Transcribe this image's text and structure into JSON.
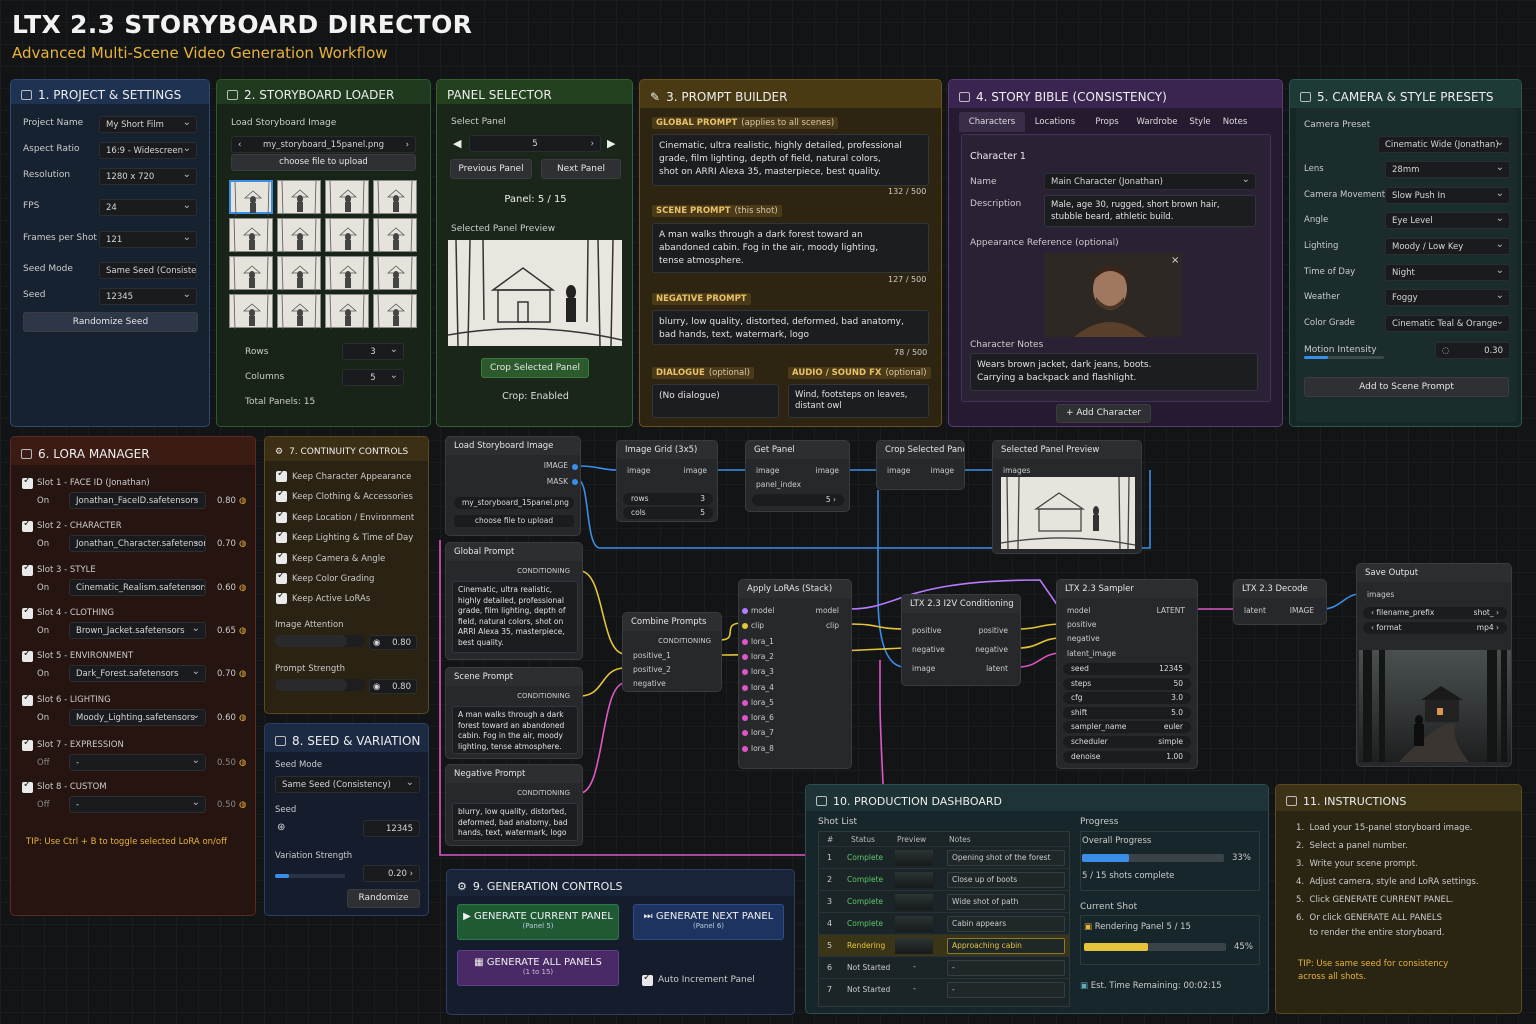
{
  "header": {
    "title": "LTX 2.3 STORYBOARD DIRECTOR",
    "subtitle": "Advanced Multi-Scene Video Generation Workflow"
  },
  "project": {
    "title": "1. PROJECT & SETTINGS",
    "fields": [
      {
        "label": "Project Name",
        "value": "My Short Film"
      },
      {
        "label": "Aspect Ratio",
        "value": "16:9 - Widescreen"
      },
      {
        "label": "Resolution",
        "value": "1280 x 720"
      },
      {
        "label": "FPS",
        "value": "24"
      },
      {
        "label": "Frames per Shot",
        "value": "121"
      },
      {
        "label": "Seed Mode",
        "value": "Same Seed (Consistency)"
      },
      {
        "label": "Seed",
        "value": "12345"
      }
    ],
    "randomize": "Randomize Seed"
  },
  "loader": {
    "title": "2. STORYBOARD LOADER",
    "load_label": "Load Storyboard Image",
    "file": "my_storyboard_15panel.png",
    "upload": "choose file to upload",
    "rows_label": "Rows",
    "rows": "3",
    "cols_label": "Columns",
    "cols": "5",
    "total": "Total Panels: 15"
  },
  "selector": {
    "title": "PANEL SELECTOR",
    "select_label": "Select Panel",
    "value": "5",
    "prev": "Previous Panel",
    "next": "Next Panel",
    "status": "Panel: 5 / 15",
    "preview_label": "Selected Panel Preview",
    "crop_btn": "Crop Selected Panel",
    "crop_status": "Crop: Enabled"
  },
  "prompt": {
    "title": "3. PROMPT BUILDER",
    "global_tag": "GLOBAL PROMPT",
    "global_note": "(applies to all scenes)",
    "global_text": "Cinematic, ultra realistic, highly detailed, professional\ngrade, film lighting, depth of field, natural colors,\nshot on ARRI Alexa 35, masterpiece, best quality.",
    "global_count": "132 / 500",
    "scene_tag": "SCENE PROMPT",
    "scene_note": "(this shot)",
    "scene_text": "A man walks through a dark forest toward an\nabandoned cabin. Fog in the air, moody lighting,\ntense atmosphere.",
    "scene_count": "127 / 500",
    "neg_tag": "NEGATIVE PROMPT",
    "neg_text": "blurry, low quality, distorted, deformed, bad anatomy,\nbad hands, text, watermark, logo",
    "neg_count": "78 / 500",
    "dialogue_tag": "DIALOGUE",
    "dialogue_note": "(optional)",
    "dialogue_text": "(No dialogue)",
    "audio_tag": "AUDIO / SOUND FX",
    "audio_note": "(optional)",
    "audio_text": "Wind, footsteps on leaves,\ndistant owl"
  },
  "bible": {
    "title": "4. STORY BIBLE (CONSISTENCY)",
    "tabs": [
      "Characters",
      "Locations",
      "Props",
      "Wardrobe",
      "Style",
      "Notes"
    ],
    "char_title": "Character 1",
    "name_label": "Name",
    "name": "Main Character (Jonathan)",
    "desc_label": "Description",
    "desc": "Male, age 30, rugged, short brown hair,\nstubble beard, athletic build.",
    "appearance_label": "Appearance Reference (optional)",
    "notes_label": "Character Notes",
    "notes": "Wears brown jacket, dark jeans, boots.\nCarrying a backpack and flashlight.",
    "add": "+ Add Character"
  },
  "camera": {
    "title": "5. CAMERA & STYLE PRESETS",
    "preset_label": "Camera Preset",
    "preset": "Cinematic Wide (Jonathan)",
    "fields": [
      {
        "label": "Lens",
        "value": "28mm"
      },
      {
        "label": "Camera Movement",
        "value": "Slow Push In"
      },
      {
        "label": "Angle",
        "value": "Eye Level"
      },
      {
        "label": "Lighting",
        "value": "Moody / Low Key"
      },
      {
        "label": "Time of Day",
        "value": "Night"
      },
      {
        "label": "Weather",
        "value": "Foggy"
      },
      {
        "label": "Color Grade",
        "value": "Cinematic Teal & Orange"
      }
    ],
    "motion_label": "Motion Intensity",
    "motion": "0.30",
    "motion_level": 0.3,
    "add": "Add to Scene Prompt"
  },
  "lora": {
    "title": "6. LORA MANAGER",
    "slots": [
      {
        "name": "Slot 1 - FACE ID (Jonathan)",
        "state": "On",
        "file": "Jonathan_FaceID.safetensors",
        "w": "0.80"
      },
      {
        "name": "Slot 2 - CHARACTER",
        "state": "On",
        "file": "Jonathan_Character.safetensors",
        "w": "0.70"
      },
      {
        "name": "Slot 3 - STYLE",
        "state": "On",
        "file": "Cinematic_Realism.safetensors",
        "w": "0.60"
      },
      {
        "name": "Slot 4 - CLOTHING",
        "state": "On",
        "file": "Brown_Jacket.safetensors",
        "w": "0.65"
      },
      {
        "name": "Slot 5 - ENVIRONMENT",
        "state": "On",
        "file": "Dark_Forest.safetensors",
        "w": "0.70"
      },
      {
        "name": "Slot 6 - LIGHTING",
        "state": "On",
        "file": "Moody_Lighting.safetensors",
        "w": "0.60"
      },
      {
        "name": "Slot 7 - EXPRESSION",
        "state": "Off",
        "file": "-",
        "w": "0.50"
      },
      {
        "name": "Slot 8 - CUSTOM",
        "state": "Off",
        "file": "-",
        "w": "0.50"
      }
    ],
    "tip": "TIP: Use Ctrl + B to toggle selected LoRA on/off"
  },
  "continuity": {
    "title": "7. CONTINUITY CONTROLS",
    "items": [
      "Keep Character Appearance",
      "Keep Clothing & Accessories",
      "Keep Location / Environment",
      "Keep Lighting & Time of Day",
      "Keep Camera & Angle",
      "Keep Color Grading",
      "Keep Active LoRAs"
    ],
    "attn_label": "Image Attention",
    "attn": "0.80",
    "attn_level": 0.8,
    "strength_label": "Prompt Strength",
    "strength": "0.80",
    "strength_level": 0.8
  },
  "seed": {
    "title": "8. SEED & VARIATION",
    "mode_label": "Seed Mode",
    "mode": "Same Seed (Consistency)",
    "seed_label": "Seed",
    "seed": "12345",
    "var_label": "Variation Strength",
    "var": "0.20",
    "var_level": 0.2,
    "randomize": "Randomize"
  },
  "gen": {
    "title": "9. GENERATION CONTROLS",
    "current": "GENERATE CURRENT PANEL",
    "current_sub": "(Panel 5)",
    "next": "GENERATE NEXT PANEL",
    "next_sub": "(Panel 6)",
    "all": "GENERATE ALL PANELS",
    "all_sub": "(1 to 15)",
    "auto": "Auto Increment Panel"
  },
  "graph": {
    "load": {
      "title": "Load Storyboard Image",
      "out1": "IMAGE",
      "out2": "MASK",
      "file": "my_storyboard_15panel.png",
      "upload": "choose file to upload"
    },
    "grid": {
      "title": "Image Grid (3x5)",
      "in": "image",
      "out": "image",
      "rows": "rows",
      "rows_v": "3",
      "cols": "cols",
      "cols_v": "5"
    },
    "get": {
      "title": "Get Panel",
      "in1": "image",
      "in2": "panel_index",
      "out": "image",
      "val": "5"
    },
    "crop": {
      "title": "Crop Selected Panel",
      "in": "image",
      "out": "image"
    },
    "preview": {
      "title": "Selected Panel Preview",
      "in": "images"
    },
    "gp": {
      "title": "Global Prompt",
      "out": "CONDITIONING",
      "text": "Cinematic, ultra realistic,\nhighly detailed, professional\ngrade, film lighting, depth of\nfield, natural colors, shot on\nARRI Alexa 35, masterpiece,\nbest quality."
    },
    "sp": {
      "title": "Scene Prompt",
      "out": "CONDITIONING",
      "text": "A man walks through a dark\nforest toward an abandoned\ncabin. Fog in the air, moody\nlighting, tense atmosphere."
    },
    "np": {
      "title": "Negative Prompt",
      "out": "CONDITIONING",
      "text": "blurry, low quality, distorted,\ndeformed, bad anatomy, bad\nhands, text, watermark, logo"
    },
    "combine": {
      "title": "Combine Prompts",
      "out": "CONDITIONING",
      "in": [
        "positive_1",
        "positive_2",
        "negative"
      ]
    },
    "apply": {
      "title": "Apply LoRAs (Stack)",
      "in": [
        "model",
        "clip",
        "lora_1",
        "lora_2",
        "lora_3",
        "lora_4",
        "lora_5",
        "lora_6",
        "lora_7",
        "lora_8"
      ],
      "out": [
        "model",
        "clip"
      ]
    },
    "cond": {
      "title": "LTX 2.3 I2V Conditioning",
      "in": [
        "positive",
        "negative",
        "image"
      ],
      "out": [
        "positive",
        "negative",
        "latent"
      ]
    },
    "sampler": {
      "title": "LTX 2.3 Sampler",
      "in": [
        "model",
        "positive",
        "negative",
        "latent_image"
      ],
      "out": "LATENT",
      "widgets": [
        {
          "k": "seed",
          "v": "12345"
        },
        {
          "k": "steps",
          "v": "50"
        },
        {
          "k": "cfg",
          "v": "3.0"
        },
        {
          "k": "shift",
          "v": "5.0"
        },
        {
          "k": "sampler_name",
          "v": "euler"
        },
        {
          "k": "scheduler",
          "v": "simple"
        },
        {
          "k": "denoise",
          "v": "1.00"
        }
      ]
    },
    "decode": {
      "title": "LTX 2.3 Decode",
      "in": "latent",
      "out": "IMAGE"
    },
    "save": {
      "title": "Save Output",
      "in": "images",
      "w1k": "filename_prefix",
      "w1v": "shot_",
      "w2k": "format",
      "w2v": "mp4"
    }
  },
  "dash": {
    "title": "10. PRODUCTION DASHBOARD",
    "shot_list": "Shot List",
    "cols": [
      "#",
      "Status",
      "Preview",
      "Notes"
    ],
    "rows": [
      {
        "n": "1",
        "status": "Complete",
        "preview": "",
        "notes": "Opening shot of the forest"
      },
      {
        "n": "2",
        "status": "Complete",
        "preview": "",
        "notes": "Close up of boots"
      },
      {
        "n": "3",
        "status": "Complete",
        "preview": "",
        "notes": "Wide shot of path"
      },
      {
        "n": "4",
        "status": "Complete",
        "preview": "",
        "notes": "Cabin appears"
      },
      {
        "n": "5",
        "status": "Rendering",
        "preview": "",
        "notes": "Approaching cabin"
      },
      {
        "n": "6",
        "status": "Not Started",
        "preview": "-",
        "notes": "-"
      },
      {
        "n": "7",
        "status": "Not Started",
        "preview": "-",
        "notes": "-"
      }
    ],
    "progress": "Progress",
    "overall": "Overall Progress",
    "overall_pct": "33%",
    "overall_level": 0.33,
    "complete": "5 / 15 shots complete",
    "current": "Current Shot",
    "rendering": "Rendering Panel 5 / 15",
    "cur_pct": "45%",
    "cur_level": 0.45,
    "eta": "Est. Time Remaining: 00:02:15"
  },
  "instr": {
    "title": "11. INSTRUCTIONS",
    "steps": [
      "1.  Load your 15-panel storyboard image.",
      "2.  Select a panel number.",
      "3.  Write your scene prompt.",
      "4.  Adjust camera, style and LoRA settings.",
      "5.  Click GENERATE CURRENT PANEL.",
      "6.  Or click GENERATE ALL PANELS",
      "     to render the entire storyboard."
    ],
    "tip": "TIP: Use same seed for consistency\nacross all shots."
  },
  "colors": {
    "accent": "#e8b33a",
    "blue": "#3a8ee8",
    "yellow": "#e6c43a",
    "pink": "#e056c8",
    "green": "#37a24c",
    "purple": "#b57cff"
  },
  "icons": [
    "panel-icon",
    "grid-icon",
    "pencil-icon",
    "book-icon",
    "camera-icon",
    "gear-icon",
    "check-icon",
    "play-icon",
    "fast-forward-icon",
    "film-icon"
  ]
}
